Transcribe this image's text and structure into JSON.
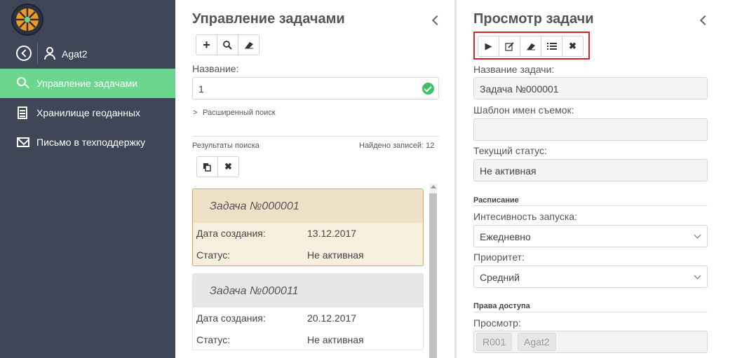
{
  "sidebar": {
    "user": "Agat2",
    "items": [
      {
        "label": "Управление задачами",
        "icon": "search-icon"
      },
      {
        "label": "Хранилище геоданных",
        "icon": "database-icon"
      },
      {
        "label": "Письмо в техподдержку",
        "icon": "mail-icon"
      }
    ]
  },
  "left": {
    "title": "Управление задачами",
    "name_label": "Название:",
    "name_value": "1",
    "advanced": "Расширенный поиск",
    "results_label": "Результаты поиска",
    "found": "Найдено записей: 12",
    "cards": [
      {
        "title": "Задача №000001",
        "date_label": "Дата создания:",
        "date": "13.12.2017",
        "status_label": "Статус:",
        "status": "Не активная"
      },
      {
        "title": "Задача №000011",
        "date_label": "Дата создания:",
        "date": "20.12.2017",
        "status_label": "Статус:",
        "status": "Не активная"
      }
    ]
  },
  "right": {
    "title": "Просмотр задачи",
    "task_name_label": "Название задачи:",
    "task_name": "Задача №000001",
    "template_label": "Шаблон имен съемок:",
    "template_value": "",
    "status_label": "Текущий статус:",
    "status_value": "Не активная",
    "schedule_title": "Расписание",
    "intensity_label": "Интесивность запуска:",
    "intensity_value": "Ежедневно",
    "priority_label": "Приоритет:",
    "priority_value": "Средний",
    "access_title": "Права доступа",
    "view_label": "Просмотр:",
    "view_tags": [
      "R001",
      "Agat2"
    ]
  },
  "colors": {
    "sidebar": "#3f4658",
    "active": "#6dd68e",
    "highlight": "#d9222a",
    "selected_card": "#f7efdd"
  }
}
